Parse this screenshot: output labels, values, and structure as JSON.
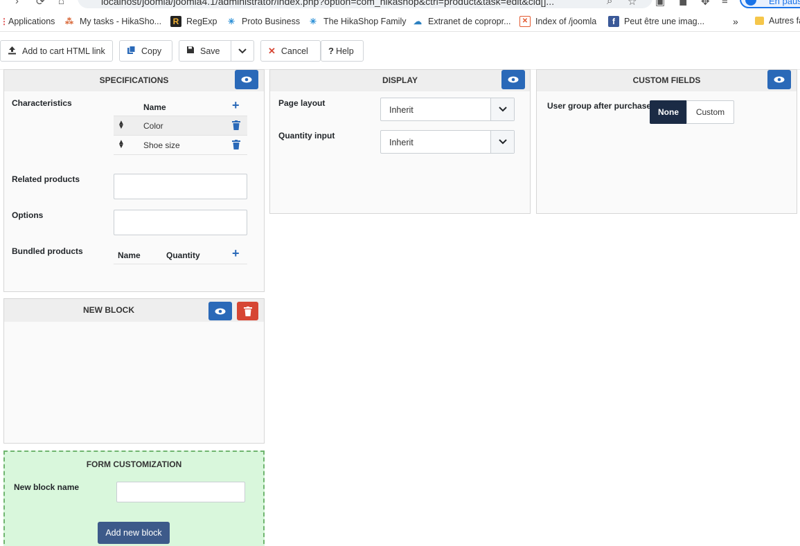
{
  "browser": {
    "url": "localhost/joomla/joomla4.1/administrator/index.php?option=com_hikashop&ctrl=product&task=edit&cid[]...",
    "profile_label": "En pause",
    "bookmarks": [
      "Applications",
      "My tasks - HikaSho...",
      "RegExp",
      "Proto Business",
      "The HikaShop Family",
      "Extranet de copropr...",
      "Index of /joomla",
      "Peut être une imag..."
    ],
    "more": "»",
    "other_bookmarks": "Autres fa"
  },
  "toolbar": {
    "add_to_cart": "Add to cart HTML link",
    "copy": "Copy",
    "save": "Save",
    "cancel": "Cancel",
    "help": "Help"
  },
  "specifications": {
    "title": "SPECIFICATIONS",
    "characteristics_label": "Characteristics",
    "char_header": "Name",
    "characteristics": [
      "Color",
      "Shoe size"
    ],
    "related_label": "Related products",
    "options_label": "Options",
    "bundled_label": "Bundled products",
    "bundled_name": "Name",
    "bundled_quantity": "Quantity"
  },
  "display": {
    "title": "DISPLAY",
    "page_layout_label": "Page layout",
    "page_layout_value": "Inherit",
    "quantity_input_label": "Quantity input",
    "quantity_input_value": "Inherit"
  },
  "custom_fields": {
    "title": "CUSTOM FIELDS",
    "user_group_label": "User group after purchase",
    "none": "None",
    "custom": "Custom"
  },
  "new_block": {
    "title": "NEW BLOCK"
  },
  "form_customization": {
    "title": "FORM CUSTOMIZATION",
    "block_name_label": "New block name",
    "add_button": "Add new block"
  },
  "colors": {
    "primary": "#2a69b8",
    "danger": "#d64634",
    "dark": "#1b2b45",
    "form_bg": "#d9f7dc",
    "form_border": "#6fb56f",
    "add_button": "#3d5a8a"
  }
}
